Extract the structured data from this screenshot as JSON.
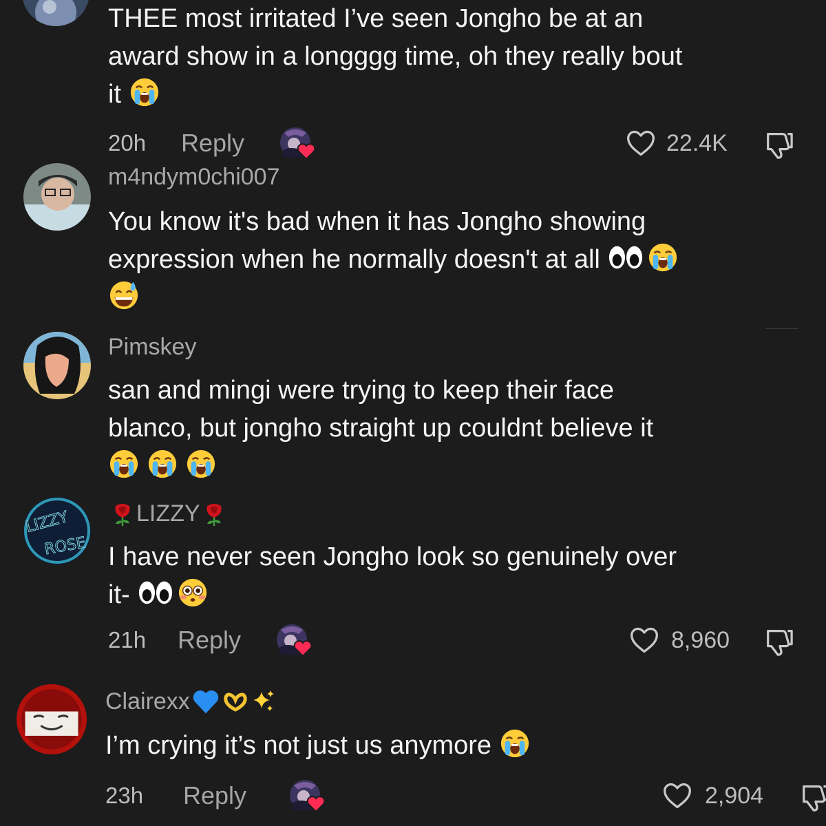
{
  "comments": [
    {
      "username": "",
      "text_lines": [
        "THEE most irritated I’ve seen Jongho be at an",
        "award show in a longggg time, oh they really bout",
        "it"
      ],
      "emojis_after": "crying-face",
      "time": "20h",
      "reply_label": "Reply",
      "likes": "22.4K"
    },
    {
      "username": "m4ndym0chi007",
      "text_lines": [
        "You know it's bad when it has Jongho showing",
        "expression when he normally doesn't at all"
      ],
      "emojis_line2": [
        "eyes",
        "crying-face"
      ],
      "emojis_line3": [
        "grinning-sweat-face"
      ]
    },
    {
      "username": "Pimskey",
      "text_lines": [
        "san and mingi were trying to keep their face",
        "blanco, but jongho straight up couldnt believe it"
      ],
      "emojis_line3": [
        "crying-face",
        "crying-face",
        "crying-face"
      ]
    },
    {
      "username": "LIZZY",
      "username_emojis": [
        "rose",
        "rose"
      ],
      "avatar_text_1": "LIZZY",
      "avatar_text_2": "ROSE",
      "text_lines": [
        "I have never seen Jongho look so genuinely over",
        "it-"
      ],
      "emojis_after": [
        "eyes",
        "flushed-face"
      ],
      "time": "21h",
      "reply_label": "Reply",
      "likes": "8,960"
    },
    {
      "username": "Clairexx",
      "username_emojis": [
        "blue-heart",
        "heart-hands",
        "sparkles"
      ],
      "text_lines": [
        "I’m crying it’s not just us anymore"
      ],
      "emojis_after": [
        "crying-face"
      ],
      "time": "23h",
      "reply_label": "Reply",
      "likes": "2,904"
    }
  ],
  "colors": {
    "background": "#1c1c1c",
    "text": "#f4f4f4",
    "username": "#a8a8a8",
    "meta": "#bdbdbd",
    "creator_heart": "#fe2c55"
  },
  "icons": [
    "heart-outline-icon",
    "dislike-icon",
    "creator-liked-icon"
  ]
}
